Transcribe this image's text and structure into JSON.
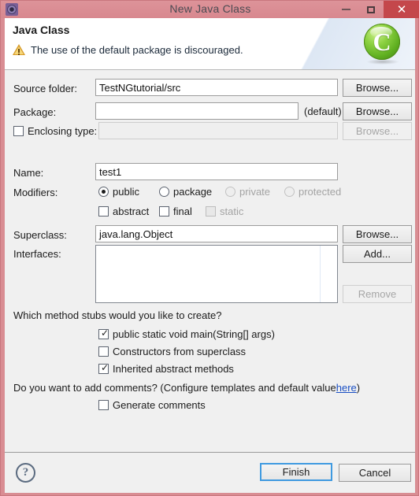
{
  "window": {
    "title": "New Java Class",
    "icon": "eclipse-gear-icon",
    "minimize_label": "–",
    "maximize_label": "□",
    "close_label": "✕",
    "titlebar_color": "#d8888f",
    "close_button_color": "#c4474b"
  },
  "banner": {
    "heading": "Java Class",
    "message": "The use of the default package is discouraged.",
    "message_icon": "warning-triangle-icon",
    "logo_letter": "C",
    "logo_icon": "java-class-green-ball-icon",
    "logo_color": "#8ed243"
  },
  "form": {
    "source_folder": {
      "label": "Source folder:",
      "value": "TestNGtutorial/src",
      "placeholder": "",
      "browse_label": "Browse..."
    },
    "package": {
      "label": "Package:",
      "value": "",
      "placeholder": "",
      "suffix": "(default)",
      "browse_label": "Browse..."
    },
    "enclosing_type": {
      "label": "Enclosing type:",
      "checked": false,
      "value": "",
      "placeholder": "",
      "browse_label": "Browse...",
      "enabled": false
    },
    "name": {
      "label": "Name:",
      "value": "test1",
      "placeholder": ""
    },
    "modifiers": {
      "label": "Modifiers:",
      "access": [
        {
          "label": "public",
          "selected": true,
          "enabled": true
        },
        {
          "label": "package",
          "selected": false,
          "enabled": true
        },
        {
          "label": "private",
          "selected": false,
          "enabled": false
        },
        {
          "label": "protected",
          "selected": false,
          "enabled": false
        }
      ],
      "flags": [
        {
          "label": "abstract",
          "checked": false,
          "enabled": true
        },
        {
          "label": "final",
          "checked": false,
          "enabled": true
        },
        {
          "label": "static",
          "checked": false,
          "enabled": false
        }
      ]
    },
    "superclass": {
      "label": "Superclass:",
      "value": "java.lang.Object",
      "placeholder": "",
      "browse_label": "Browse..."
    },
    "interfaces": {
      "label": "Interfaces:",
      "items": [],
      "add_label": "Add...",
      "remove_label": "Remove",
      "remove_enabled": false
    }
  },
  "stubs": {
    "question": "Which method stubs would you like to create?",
    "options": [
      {
        "label": "public static void main(String[] args)",
        "checked": true
      },
      {
        "label": "Constructors from superclass",
        "checked": false
      },
      {
        "label": "Inherited abstract methods",
        "checked": true
      }
    ]
  },
  "comments": {
    "question_prefix": "Do you want to add comments? (Configure templates and default value ",
    "link_label": "here",
    "question_suffix": ")",
    "option": {
      "label": "Generate comments",
      "checked": false
    }
  },
  "footer": {
    "help_label": "?",
    "help_icon": "question-mark-circle-icon",
    "finish_label": "Finish",
    "cancel_label": "Cancel",
    "default_button": "Finish",
    "focus_color": "#3f9ae0"
  }
}
